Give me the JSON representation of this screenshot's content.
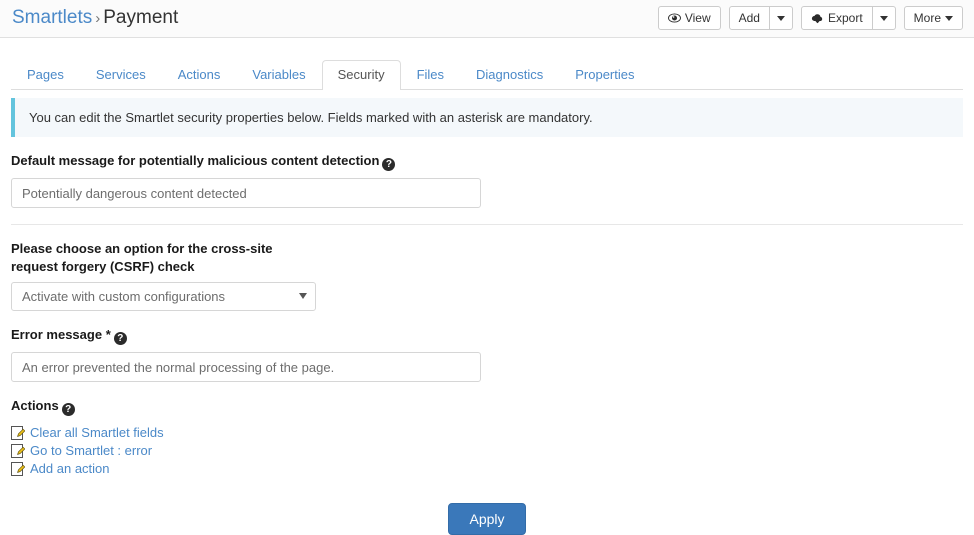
{
  "header": {
    "breadcrumb": {
      "root": "Smartlets",
      "separator": "›",
      "current": "Payment"
    },
    "buttons": {
      "view": "View",
      "view_icon": "eye-icon",
      "add": "Add",
      "add_caret": "chevron-down-icon",
      "export": "Export",
      "export_icon": "cloud-download-icon",
      "export_caret": "chevron-down-icon",
      "more": "More",
      "more_caret": "chevron-down-icon"
    }
  },
  "tabs": [
    {
      "label": "Pages",
      "active": false
    },
    {
      "label": "Services",
      "active": false
    },
    {
      "label": "Actions",
      "active": false
    },
    {
      "label": "Variables",
      "active": false
    },
    {
      "label": "Security",
      "active": true
    },
    {
      "label": "Files",
      "active": false
    },
    {
      "label": "Diagnostics",
      "active": false
    },
    {
      "label": "Properties",
      "active": false
    }
  ],
  "main": {
    "alert": "You can edit the Smartlet security properties below. Fields marked with an asterisk are mandatory.",
    "fields": {
      "malicious_content": {
        "label": "Default message for potentially malicious content detection",
        "help_icon": "help-circle-icon",
        "value": "Potentially dangerous content detected"
      },
      "csrf": {
        "label": "Please choose an option for the cross-site request forgery (CSRF) check",
        "selected": "Activate with custom configurations",
        "arrow_icon": "chevron-down-icon"
      },
      "error_message": {
        "label": "Error message",
        "required_marker": "*",
        "help_icon": "help-circle-icon",
        "value": "An error prevented the normal processing of the page."
      }
    },
    "actions": {
      "label": "Actions",
      "help_icon": "help-circle-icon",
      "items": [
        {
          "label": "Clear all Smartlet fields",
          "icon": "edit-page-icon"
        },
        {
          "label": "Go to Smartlet : error",
          "icon": "edit-page-icon"
        },
        {
          "label": "Add an action",
          "icon": "edit-page-icon"
        }
      ]
    },
    "apply_button": "Apply"
  },
  "colors": {
    "link": "#4b89c8",
    "primary_button": "#3a78ba",
    "alert_border": "#63c4dd",
    "alert_bg": "#f4f8fb"
  }
}
